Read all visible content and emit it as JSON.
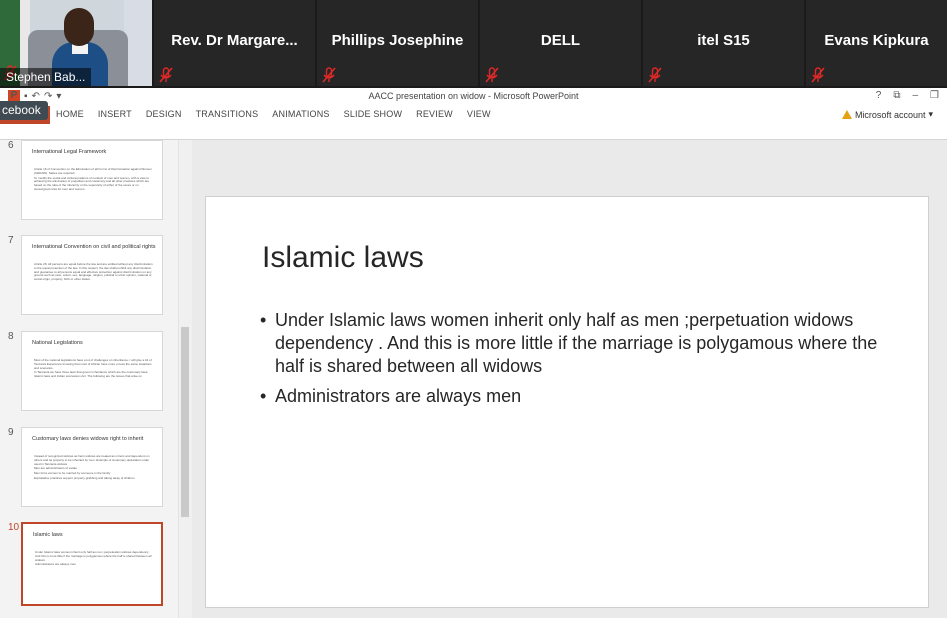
{
  "participants": [
    {
      "name": "Stephen Bab..."
    },
    {
      "name": "Rev. Dr Margare..."
    },
    {
      "name": "Phillips Josephine"
    },
    {
      "name": "DELL"
    },
    {
      "name": "itel S15"
    },
    {
      "name": "Evans Kipkura"
    }
  ],
  "overlay": {
    "facebook_label": "cebook"
  },
  "window": {
    "title": "AACC presentation on widow - Microsoft PowerPoint"
  },
  "ribbon": {
    "tabs": [
      "HOME",
      "INSERT",
      "DESIGN",
      "TRANSITIONS",
      "ANIMATIONS",
      "SLIDE SHOW",
      "REVIEW",
      "VIEW"
    ],
    "account": "Microsoft account",
    "help": "?"
  },
  "thumbnails": [
    {
      "num": "6",
      "title": "International Legal Framework",
      "lines": [
        "Article 16 of Convention on the Elimination of all Forms of Discrimination against Women (CEDAW). States are required:",
        "To modify the social and cultural patterns of conduct of men and women, with a view to achieving the elimination of prejudices and customary and all other practices which are based on the idea of the inferiority or the superiority of either of the sexes or on stereotyped roles for men and women."
      ]
    },
    {
      "num": "7",
      "title": "International Convention on civil and political rights",
      "lines": [
        "Article 26: All persons are equal before the law and are entitled without any discrimination to the equal protection of the law. In this respect, the law shall prohibit any discrimination and guarantee to all persons equal and effective protection against discrimination on any ground such as race, colour, sex, language, religion, political or other opinion, national or social origin, property, birth or other status."
      ]
    },
    {
      "num": "8",
      "title": "National Legislations",
      "lines": [
        "Most of the national legislations have a lot of challenges on inheritance. I will give a bit of Tanzania Experience knowing that most of African have more or less the same situations and scenarios.",
        "In Tanzania we have three laws that govern inheritance which are the customary laws, Islamic laws and Indian succession Act. The following are the issues that arise on"
      ]
    },
    {
      "num": "9",
      "title": "Customary laws denies widows right to inherit",
      "lines": [
        "Instead of recognized widows as heirs widows are treated as minors and dependent on others and as property to be inherited by men. Example of customary declaration order used in Tanzania widows",
        "Men are administrators of estate",
        "Men force women to be married by someone in the family",
        "Exploitative practices support property grabbing and taking away of children"
      ]
    },
    {
      "num": "10",
      "title": "Islamic laws",
      "lines": [
        "Under Islamic laws women inherit only half as men ;perpetuation widows dependency . And this is more little if the marriage is polygamous where the half is shared between all widows",
        "Administrators are always men"
      ]
    }
  ],
  "slide": {
    "title": "Islamic laws",
    "bullets": [
      "Under Islamic laws women inherit  only half as men ;perpetuation widows dependency . And this is more little if the marriage is polygamous where the half is shared between all widows",
      "Administrators are always men"
    ]
  },
  "colors": {
    "accent": "#c0462a",
    "strip_bg": "#1a1a1a",
    "tile_bg": "#262626",
    "mute_red": "#e02828"
  },
  "icons": [
    "muted-mic-icon",
    "powerpoint-logo-icon",
    "save-icon",
    "undo-icon",
    "redo-icon",
    "warning-icon"
  ]
}
